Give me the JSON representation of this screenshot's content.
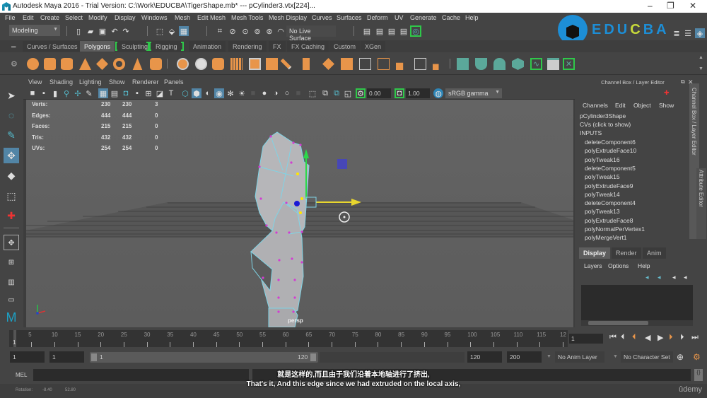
{
  "window": {
    "title": "Autodesk Maya 2016 - Trial Version: C:\\Work\\EDUCBA\\TigerShape.mb*  ---   pCylinder3.vtx[224]...",
    "minimize": "–",
    "restore": "❐",
    "close": "✕"
  },
  "menubar": [
    "File",
    "Edit",
    "Create",
    "Select",
    "Modify",
    "Display",
    "Windows",
    "Mesh",
    "Edit Mesh",
    "Mesh Tools",
    "Mesh Display",
    "Curves",
    "Surfaces",
    "Deform",
    "UV",
    "Generate",
    "Cache",
    "Help"
  ],
  "status_line": {
    "mode": "Modeling",
    "live_surface": "No Live Surface",
    "icons": [
      "new-scene-icon",
      "open-scene-icon",
      "save-scene-icon",
      "undo-icon",
      "redo-icon",
      "select-hierarchy-icon",
      "select-object-icon",
      "select-component-icon",
      "snap-grid-icon",
      "snap-curve-icon",
      "snap-point-icon",
      "snap-projected-icon",
      "snap-view-icon",
      "make-live-icon",
      "render-view-icon",
      "render-frame-icon",
      "ipr-render-icon",
      "render-settings-icon",
      "hypershade-icon"
    ]
  },
  "brand": {
    "name": "EDUCBA",
    "colors": [
      "#1d8ed6",
      "#1d8ed6",
      "#1d8ed6",
      "#c7d93a",
      "#1d8ed6",
      "#1d8ed6"
    ]
  },
  "shelf": {
    "tabs": [
      "Curves / Surfaces",
      "Polygons",
      "Sculpting",
      "Rigging",
      "Animation",
      "Rendering",
      "FX",
      "FX Caching",
      "Custom",
      "XGen"
    ],
    "active_tab": "Polygons",
    "poly_icons": [
      "poly-sphere-icon",
      "poly-cube-icon",
      "poly-cylinder-icon",
      "poly-cone-icon",
      "poly-plane-icon",
      "poly-torus-icon",
      "poly-pyramid-icon",
      "poly-pipe-icon"
    ],
    "tool_icons": [
      "combine-icon",
      "separate-icon",
      "mirror-icon",
      "smooth-icon",
      "reduce-icon",
      "boolean-icon",
      "bevel-icon",
      "bridge-icon",
      "extrude-icon",
      "append-icon",
      "fill-hole-icon",
      "multi-cut-icon",
      "target-weld-icon",
      "connect-icon",
      "quad-draw-icon",
      "uv-icon"
    ],
    "uv_icons": [
      "planar-map-icon",
      "cylindrical-map-icon",
      "spherical-map-icon",
      "automatic-map-icon",
      "unfold-icon",
      "uv-editor-icon",
      "uv-layout-icon"
    ]
  },
  "viewport": {
    "menu": [
      "View",
      "Shading",
      "Lighting",
      "Show",
      "Renderer",
      "Panels"
    ],
    "gamma_value_1": "0.00",
    "gamma_value_2": "1.00",
    "color_space": "sRGB gamma",
    "camera_label": "persp",
    "hud": [
      {
        "label": "Verts:",
        "a": "230",
        "b": "230",
        "c": "3"
      },
      {
        "label": "Edges:",
        "a": "444",
        "b": "444",
        "c": "0"
      },
      {
        "label": "Faces:",
        "a": "215",
        "b": "215",
        "c": "0"
      },
      {
        "label": "Tris:",
        "a": "432",
        "b": "432",
        "c": "0"
      },
      {
        "label": "UVs:",
        "a": "254",
        "b": "254",
        "c": "0"
      }
    ]
  },
  "toolbox": [
    "select-tool-icon",
    "lasso-tool-icon",
    "paint-select-icon",
    "move-tool-icon",
    "rotate-tool-icon",
    "scale-tool-icon",
    "universal-manipulator-icon",
    "single-perspective-layout-icon",
    "four-view-layout-icon",
    "two-pane-layout-icon",
    "outliner-layout-icon",
    "maya-logo-icon"
  ],
  "channel_box": {
    "header": "Channel Box / Layer Editor",
    "menu": [
      "Channels",
      "Edit",
      "Object",
      "Show"
    ],
    "object": "pCylinder3Shape",
    "cvs": "CVs (click to show)",
    "inputs_label": "INPUTS",
    "inputs": [
      "deleteComponent6",
      "polyExtrudeFace10",
      "polyTweak16",
      "deleteComponent5",
      "polyTweak15",
      "polyExtrudeFace9",
      "polyTweak14",
      "deleteComponent4",
      "polyTweak13",
      "polyExtrudeFace8",
      "polyNormalPerVertex1",
      "polyMergeVert1"
    ],
    "side_tabs": [
      "Channel Box / Layer Editor",
      "Attribute Editor"
    ]
  },
  "layer_editor": {
    "tabs": [
      "Display",
      "Render",
      "Anim"
    ],
    "active_tab": "Display",
    "menu": [
      "Layers",
      "Options",
      "Help"
    ]
  },
  "timeline": {
    "start": 1,
    "end": 120,
    "ticks": [
      "5",
      "10",
      "15",
      "20",
      "25",
      "30",
      "35",
      "40",
      "45",
      "50",
      "55",
      "60",
      "65",
      "70",
      "75",
      "80",
      "85",
      "90",
      "95",
      "100",
      "105",
      "110",
      "115",
      "12"
    ],
    "current_frame_marker": "1",
    "current_frame": "1"
  },
  "range": {
    "start_time": "1",
    "playback_start": "1",
    "slider_start": "1",
    "slider_end": "120",
    "playback_end": "120",
    "end_time": "200",
    "anim_layer": "No Anim Layer",
    "character_set": "No Character Set"
  },
  "command_line": {
    "label": "MEL",
    "value": ""
  },
  "status": {
    "label": "Rotation:",
    "x": "-8.40",
    "y": "52.80"
  },
  "subtitles": {
    "zh": "就是这样的,而且由于我们沿着本地轴进行了挤出,",
    "en": "That's it, And this edge since we had extruded on the local axis,"
  },
  "watermark": "ûdemy"
}
